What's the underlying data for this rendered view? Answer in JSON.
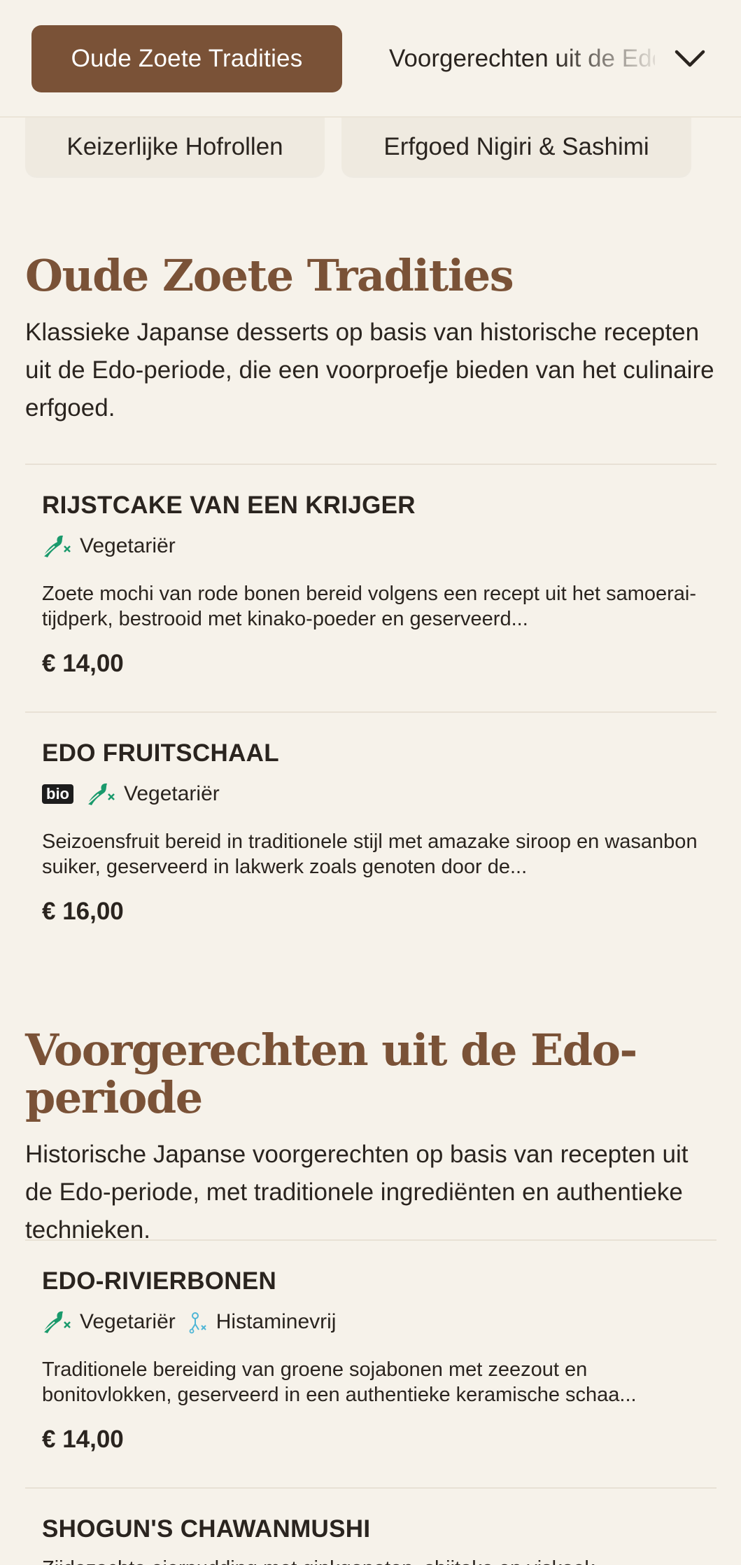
{
  "nav": {
    "active_category": "Oude Zoete Tradities",
    "next_category": "Voorgerechten uit de Edo-periode",
    "chips": [
      "Keizerlijke Hofrollen",
      "Erfgoed Nigiri & Sashimi"
    ]
  },
  "sections": [
    {
      "title": "Oude Zoete Tradities",
      "description": "Klassieke Japanse desserts op basis van historische recepten uit de Edo-periode, die een voorproefje bieden van het culinaire erfgoed.",
      "items": [
        {
          "name": "RIJSTCAKE VAN EEN KRIJGER",
          "tags": [
            "Vegetariër"
          ],
          "description": "Zoete mochi van rode bonen bereid volgens een recept uit het samoerai-tijdperk, bestrooid met kinako-poeder en geserveerd...",
          "price": "€ 14,00"
        },
        {
          "name": "EDO FRUITSCHAAL",
          "badge": "bio",
          "tags": [
            "Vegetariër"
          ],
          "description": "Seizoensfruit bereid in traditionele stijl met amazake siroop en wasanbon suiker, geserveerd in lakwerk zoals genoten door de...",
          "price": "€ 16,00"
        }
      ]
    },
    {
      "title": "Voorgerechten uit de Edo-periode",
      "description": "Historische Japanse voorgerechten op basis van recepten uit de Edo-periode, met traditionele ingrediënten en authentieke technieken.",
      "items": [
        {
          "name": "EDO-RIVIERBONEN",
          "tags": [
            "Vegetariër",
            "Histaminevrij"
          ],
          "description": "Traditionele bereiding van groene sojabonen met zeezout en bonitovlokken, geserveerd in een authentieke keramische schaa...",
          "price": "€ 14,00"
        },
        {
          "name": "SHOGUN'S CHAWANMUSHI",
          "description": "Zijdezachte eierpudding met ginkgonoten, shiitake en viskoek"
        }
      ]
    }
  ],
  "colors": {
    "accent": "#7a5237",
    "background": "#f6f2ea",
    "vegetarian_icon": "#1a9a6c",
    "histamine_icon": "#4fb6d6"
  }
}
